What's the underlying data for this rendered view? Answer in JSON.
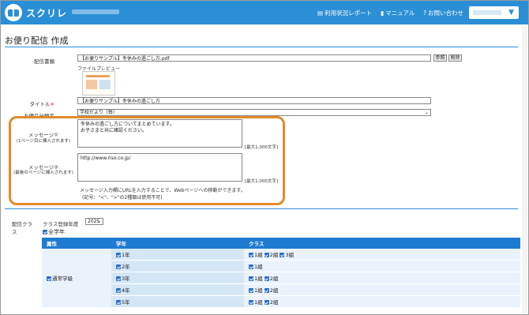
{
  "header": {
    "brand": "スクリレ",
    "nav_report": "利用状況レポート",
    "nav_manual": "マニュアル",
    "nav_contact": "お問い合わせ"
  },
  "page_title": "お便り配信 作成",
  "form": {
    "file_label": "配信書類",
    "file_value": "【お便りサンプル】冬休みの過ごし方.pdf",
    "browse_button": "参照",
    "delete_button": "削除",
    "preview_label": "ファイルプレビュー",
    "title_label": "タイトル",
    "required_mark": "※",
    "title_value": "【お便りサンプル】冬休みの過ごし方",
    "category_label": "お便り分類名",
    "category_value": "学校だより（毎）",
    "message1_label": "メッセージ①",
    "message1_sub": "(1ページ目に挿入されます)",
    "message1_line1": "冬休みの過ごし方についてまとめています。",
    "message1_line2": "お子さまと共に確認ください。",
    "message2_label": "メッセージ②",
    "message2_sub": "(最後のページに挿入されます)",
    "message2_value": "http://www.riso.co.jp/",
    "max_chars": "[最大1,000文字]",
    "note_line1": "メッセージ入力欄にURLを入力することで、Webページへの移動ができます。",
    "note_line2": "(記号：\"<\"、\">\"の2種類は使用不可)"
  },
  "class_section": {
    "label": "配信クラス",
    "year_label": "クラス登録年度",
    "year_value": "2025",
    "all_grades": "全学年",
    "col_attr": "属性",
    "col_grade": "学年",
    "col_class": "クラス",
    "attr_value": "通常学級",
    "rows": [
      {
        "grade": "1年",
        "classes": [
          "1組",
          "2組",
          "3組"
        ]
      },
      {
        "grade": "2年",
        "classes": [
          "1組"
        ]
      },
      {
        "grade": "3年",
        "classes": [
          "1組",
          "2組"
        ]
      },
      {
        "grade": "4年",
        "classes": [
          "1組",
          "2組"
        ]
      },
      {
        "grade": "5年",
        "classes": [
          "1組",
          "2組"
        ]
      }
    ]
  },
  "colors": {
    "header_blue": "#2b8fd6",
    "table_header": "#1f7bd1",
    "highlight_orange": "#e38a2a"
  }
}
